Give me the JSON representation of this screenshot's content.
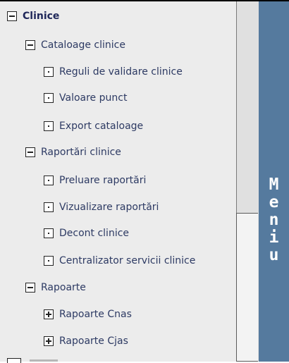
{
  "tree": {
    "root": {
      "label": "Clinice",
      "state": "expanded"
    },
    "groups": [
      {
        "label": "Cataloage clinice",
        "state": "expanded",
        "children": [
          "Reguli de validare clinice",
          "Valoare punct",
          "Export cataloage"
        ]
      },
      {
        "label": "Raportări clinice",
        "state": "expanded",
        "children": [
          "Preluare raportări",
          "Vizualizare raportări",
          "Decont clinice",
          "Centralizator servicii clinice"
        ]
      },
      {
        "label": "Rapoarte",
        "state": "expanded",
        "children": [
          "Rapoarte Cnas",
          "Rapoarte Cjas"
        ]
      }
    ]
  },
  "menu": {
    "letters": [
      "M",
      "e",
      "n",
      "i",
      "u"
    ]
  },
  "colors": {
    "menu_bg": "#557a9e",
    "tree_bg": "#ececec",
    "text": "#2d3a63"
  }
}
